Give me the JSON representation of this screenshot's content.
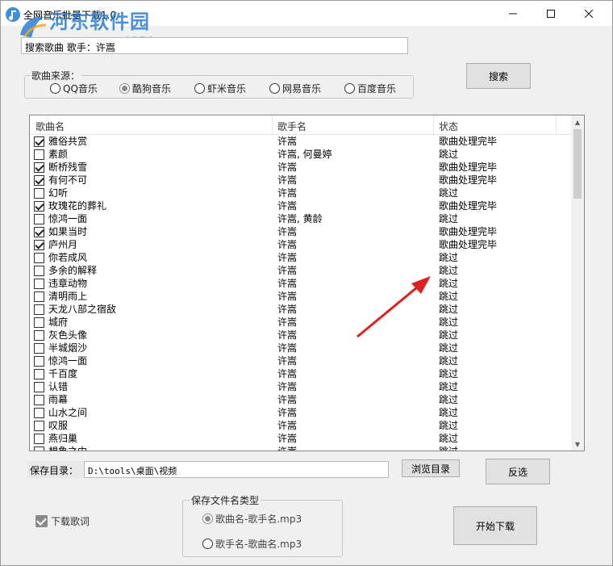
{
  "window": {
    "title": "全网音乐批量下载1.0",
    "controls": {
      "minimize": "—",
      "maximize": "☐",
      "close": "✕"
    }
  },
  "watermark": {
    "big": "河东软件园",
    "small": "www.pc0359.cn"
  },
  "search": {
    "value": "搜索歌曲 歌手：许嵩",
    "button_label": "搜索"
  },
  "source": {
    "label": "歌曲来源：",
    "options": [
      "QQ音乐",
      "酷狗音乐",
      "虾米音乐",
      "网易音乐",
      "百度音乐"
    ],
    "selected": "酷狗音乐"
  },
  "table": {
    "columns": [
      "歌曲名",
      "歌手名",
      "状态"
    ],
    "rows": [
      {
        "checked": true,
        "song": "雅俗共赏",
        "artist": "许嵩",
        "status": "歌曲处理完毕"
      },
      {
        "checked": false,
        "song": "素颜",
        "artist": "许嵩, 何曼婷",
        "status": "跳过"
      },
      {
        "checked": true,
        "song": "断桥残雪",
        "artist": "许嵩",
        "status": "歌曲处理完毕"
      },
      {
        "checked": true,
        "song": "有何不可",
        "artist": "许嵩",
        "status": "歌曲处理完毕"
      },
      {
        "checked": false,
        "song": "幻听",
        "artist": "许嵩",
        "status": "跳过"
      },
      {
        "checked": true,
        "song": "玫瑰花的葬礼",
        "artist": "许嵩",
        "status": "歌曲处理完毕"
      },
      {
        "checked": false,
        "song": "惊鸿一面",
        "artist": "许嵩, 黄龄",
        "status": "跳过"
      },
      {
        "checked": true,
        "song": "如果当时",
        "artist": "许嵩",
        "status": "歌曲处理完毕"
      },
      {
        "checked": true,
        "song": "庐州月",
        "artist": "许嵩",
        "status": "歌曲处理完毕"
      },
      {
        "checked": false,
        "song": "你若成风",
        "artist": "许嵩",
        "status": "跳过"
      },
      {
        "checked": false,
        "song": "多余的解释",
        "artist": "许嵩",
        "status": "跳过"
      },
      {
        "checked": false,
        "song": "违章动物",
        "artist": "许嵩",
        "status": "跳过"
      },
      {
        "checked": false,
        "song": "清明雨上",
        "artist": "许嵩",
        "status": "跳过"
      },
      {
        "checked": false,
        "song": "天龙八部之宿敌",
        "artist": "许嵩",
        "status": "跳过"
      },
      {
        "checked": false,
        "song": "城府",
        "artist": "许嵩",
        "status": "跳过"
      },
      {
        "checked": false,
        "song": "灰色头像",
        "artist": "许嵩",
        "status": "跳过"
      },
      {
        "checked": false,
        "song": "半城烟沙",
        "artist": "许嵩",
        "status": "跳过"
      },
      {
        "checked": false,
        "song": "惊鸿一面",
        "artist": "许嵩",
        "status": "跳过"
      },
      {
        "checked": false,
        "song": "千百度",
        "artist": "许嵩",
        "status": "跳过"
      },
      {
        "checked": false,
        "song": "认错",
        "artist": "许嵩",
        "status": "跳过"
      },
      {
        "checked": false,
        "song": "雨幕",
        "artist": "许嵩",
        "status": "跳过"
      },
      {
        "checked": false,
        "song": "山水之间",
        "artist": "许嵩",
        "status": "跳过"
      },
      {
        "checked": false,
        "song": "叹服",
        "artist": "许嵩",
        "status": "跳过"
      },
      {
        "checked": false,
        "song": "燕归巢",
        "artist": "许嵩",
        "status": "跳过"
      },
      {
        "checked": false,
        "song": "想象之中",
        "artist": "许嵩",
        "status": "跳过"
      }
    ]
  },
  "save": {
    "label": "保存目录：",
    "path": "D:\\tools\\桌面\\视频",
    "browse_label": "浏览目录",
    "invert_label": "反选"
  },
  "lyrics": {
    "label": "下载歌词",
    "checked": true
  },
  "filename_type": {
    "label": "保存文件名类型",
    "options": [
      "歌曲名-歌手名.mp3",
      "歌手名-歌曲名.mp3"
    ],
    "selected": "歌曲名-歌手名.mp3"
  },
  "start_label": "开始下载",
  "colors": {
    "annotation_arrow": "#e02020",
    "watermark_blue": "#2a7fd4",
    "watermark_green": "#2aa84a"
  }
}
